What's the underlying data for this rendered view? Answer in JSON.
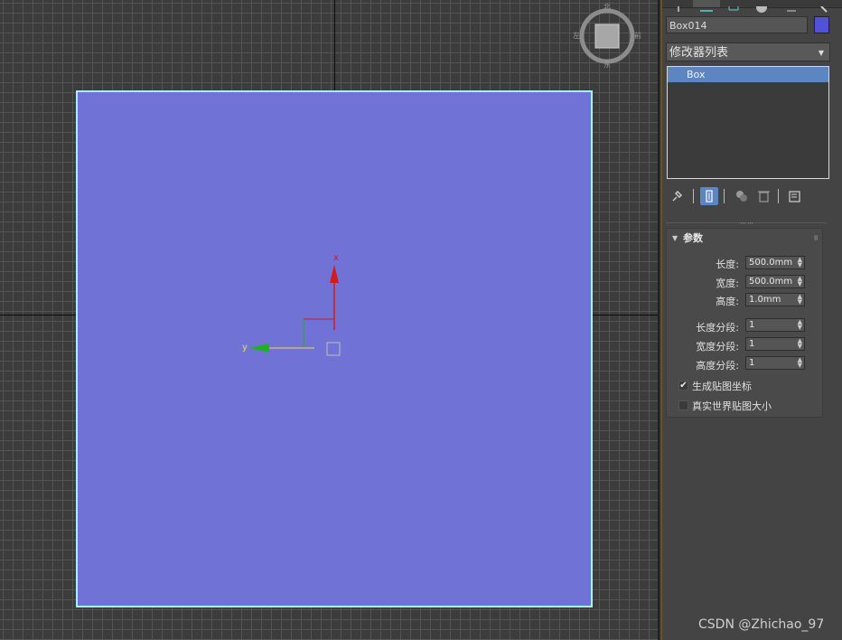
{
  "object": {
    "name": "Box014",
    "color": "#5252d9"
  },
  "modifier_list": {
    "label": "修改器列表"
  },
  "stack": {
    "items": [
      {
        "label": "Box"
      }
    ]
  },
  "viewport": {
    "box_color": "#7072d6",
    "selection_color": "#9ff4ff",
    "axis_x_label": "x",
    "axis_y_label": "y",
    "viewcube_labels": {
      "top": "北",
      "left": "左",
      "right": "前",
      "bottom": "东"
    }
  },
  "parameters": {
    "title": "参数",
    "length_label": "长度:",
    "length_value": "500.0mm",
    "width_label": "宽度:",
    "width_value": "500.0mm",
    "height_label": "高度:",
    "height_value": "1.0mm",
    "length_segs_label": "长度分段:",
    "length_segs_value": "1",
    "width_segs_label": "宽度分段:",
    "width_segs_value": "1",
    "height_segs_label": "高度分段:",
    "height_segs_value": "1",
    "gen_map_coords_label": "生成贴图坐标",
    "gen_map_coords_checked": true,
    "real_world_map_label": "真实世界贴图大小",
    "real_world_map_checked": false
  },
  "watermark": "CSDN @Zhichao_97"
}
